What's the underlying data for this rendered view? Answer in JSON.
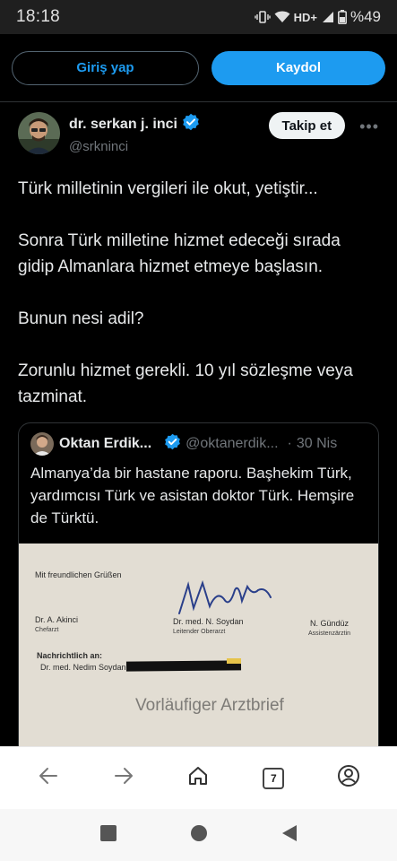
{
  "status": {
    "time": "18:18",
    "network": "HD+",
    "battery": "%49",
    "icons": [
      "vibrate-icon",
      "wifi-icon",
      "signal-icon",
      "battery-icon"
    ]
  },
  "auth": {
    "login_label": "Giriş yap",
    "signup_label": "Kaydol"
  },
  "tweet": {
    "author_name": "dr. serkan j. inci",
    "author_handle": "@srkninci",
    "follow_label": "Takip et",
    "more_label": "•••",
    "text": "Türk milletinin vergileri ile okut, yetiştir...\n\nSonra Türk milletine hizmet edeceği sırada gidip Almanlara hizmet etmeye başlasın.\n\nBunun nesi adil?\n\nZorunlu hizmet gerekli. 10 yıl sözleşme veya tazminat."
  },
  "quote": {
    "author_name": "Oktan Erdik...",
    "author_handle": "@oktanerdik...",
    "separator": "·",
    "date": "30 Nis",
    "text": "Almanya’da bir hastane raporu. Başhekim Türk, yardımcısı Türk ve asistan doktor Türk. Hemşire de Türktü.",
    "media": {
      "greeting": "Mit freundlichen Grüßen",
      "sig1_name": "Dr. A. Akinci",
      "sig1_role": "Chefarzt",
      "sig2_name": "Dr. med. N. Soydan",
      "sig2_role": "Leitender Oberarzt",
      "sig3_name": "N. Gündüz",
      "sig3_role": "Assistenzärztin",
      "cc_label": "Nachrichtlich an:",
      "cc_value": "Dr. med. Nedim Soydan,",
      "title": "Vorläufiger Arztbrief"
    }
  },
  "browser": {
    "tab_count": "7",
    "icons": [
      "back-arrow-icon",
      "forward-arrow-icon",
      "home-icon",
      "tabs-icon",
      "account-icon"
    ]
  },
  "colors": {
    "accent": "#1d9bf0",
    "background": "#000000",
    "text": "#e7e9ea",
    "muted": "#71767b",
    "border": "#2f3336"
  }
}
